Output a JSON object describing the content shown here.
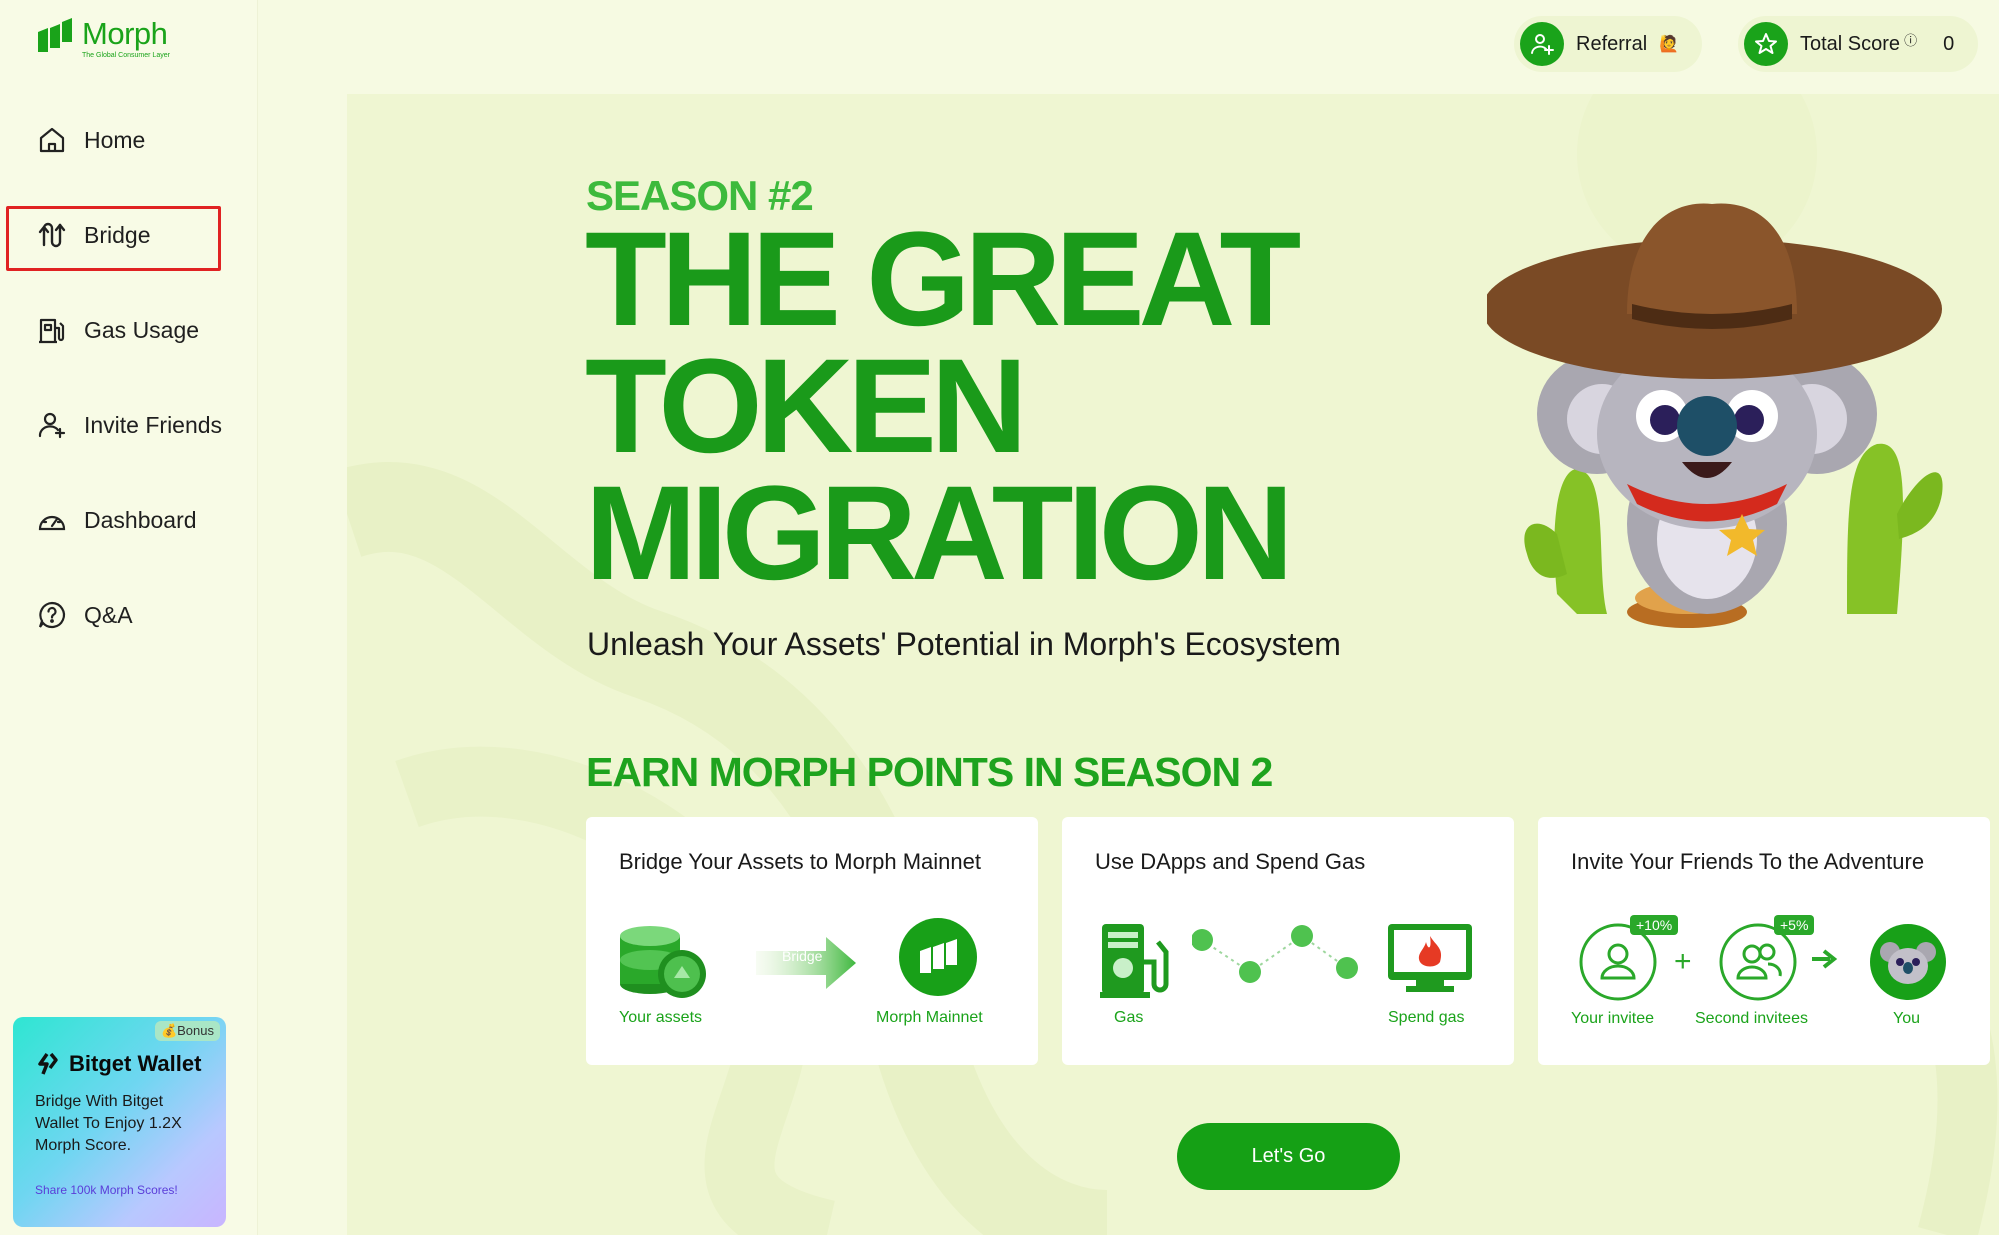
{
  "brand": {
    "name": "Morph",
    "tagline": "The Global Consumer Layer"
  },
  "sidebar": {
    "items": [
      {
        "label": "Home",
        "icon": "home-icon"
      },
      {
        "label": "Bridge",
        "icon": "bridge-icon",
        "highlighted": true
      },
      {
        "label": "Gas Usage",
        "icon": "gas-pump-icon"
      },
      {
        "label": "Invite Friends",
        "icon": "user-add-icon"
      },
      {
        "label": "Dashboard",
        "icon": "gauge-icon"
      },
      {
        "label": "Q&A",
        "icon": "question-icon"
      }
    ]
  },
  "promo": {
    "badge": "💰Bonus",
    "title": "Bitget Wallet",
    "text": "Bridge With Bitget Wallet To Enjoy 1.2X Morph Score.",
    "link": "Share 100k Morph Scores!"
  },
  "topbar": {
    "referral_label": "Referral",
    "score_label": "Total Score",
    "score_value": "0"
  },
  "hero": {
    "season": "SEASON #2",
    "title_line1": "THE GREAT",
    "title_line2": "TOKEN",
    "title_line3": "MIGRATION",
    "tagline": "Unleash Your Assets' Potential in Morph's Ecosystem",
    "earn_heading": "EARN MORPH POINTS IN SEASON 2"
  },
  "cards": [
    {
      "title": "Bridge Your Assets to Morph Mainnet",
      "arrow_label": "Bridge",
      "left_label": "Your assets",
      "right_label": "Morph Mainnet"
    },
    {
      "title": "Use DApps and Spend Gas",
      "left_label": "Gas",
      "right_label": "Spend gas"
    },
    {
      "title": "Invite Your Friends To the Adventure",
      "badge1": "+10%",
      "badge2": "+5%",
      "label1": "Your invitee",
      "label2": "Second invitees",
      "label3": "You"
    }
  ],
  "cta": {
    "label": "Let's Go"
  },
  "colors": {
    "accent": "#1aa31a",
    "background": "#f6fae2",
    "highlight": "#e02222"
  }
}
